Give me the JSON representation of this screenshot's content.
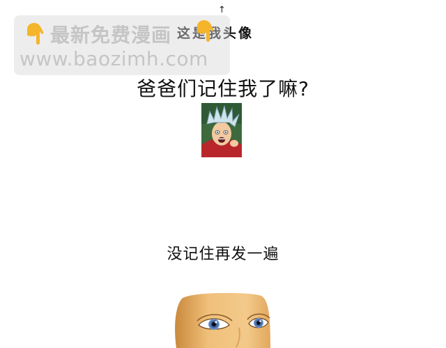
{
  "watermark": {
    "line1": "最新免费漫画",
    "line2": "www.baozimh.com",
    "icon": "pointing-down-hand-icon",
    "color": "#c3c3c3"
  },
  "caption": {
    "arrow": "↑",
    "text": "这是我头像",
    "icon": "pointing-down-hand-icon"
  },
  "main": {
    "question": "爸爸们记住我了嘛?",
    "avatar": "avatar-portrait",
    "repeat_text": "没记住再发一遍",
    "face_image": "face-closeup-image"
  },
  "colors": {
    "background": "#ffffff",
    "text": "#111111",
    "hand": "#f5b52a",
    "avatar_bg": "#3c6a3c",
    "skin": "#e8b06a",
    "eye": "#4a6fa8"
  }
}
